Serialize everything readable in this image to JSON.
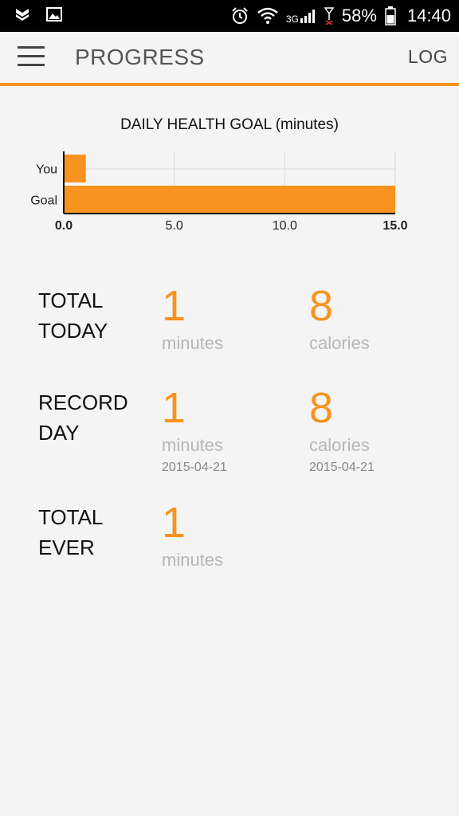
{
  "status_bar": {
    "battery": "58%",
    "time": "14:40",
    "network": "3G"
  },
  "app_bar": {
    "title": "PROGRESS",
    "log_label": "LOG"
  },
  "chart_data": {
    "type": "bar",
    "orientation": "horizontal",
    "title": "DAILY HEALTH GOAL (minutes)",
    "categories": [
      "You",
      "Goal"
    ],
    "values": [
      1,
      15
    ],
    "xlim": [
      0,
      15
    ],
    "xticks": [
      "0.0",
      "5.0",
      "10.0",
      "15.0"
    ],
    "grid": true,
    "bar_color": "#f7931e"
  },
  "stats": {
    "total_today": {
      "label_line1": "TOTAL",
      "label_line2": "TODAY",
      "minutes_value": "1",
      "minutes_unit": "minutes",
      "calories_value": "8",
      "calories_unit": "calories"
    },
    "record_day": {
      "label_line1": "RECORD",
      "label_line2": "DAY",
      "minutes_value": "1",
      "minutes_unit": "minutes",
      "minutes_date": "2015-04-21",
      "calories_value": "8",
      "calories_unit": "calories",
      "calories_date": "2015-04-21"
    },
    "total_ever": {
      "label_line1": "TOTAL",
      "label_line2": "EVER",
      "minutes_value": "1",
      "minutes_unit": "minutes"
    }
  },
  "colors": {
    "accent": "#f7931e",
    "muted": "#b6b6b6"
  }
}
